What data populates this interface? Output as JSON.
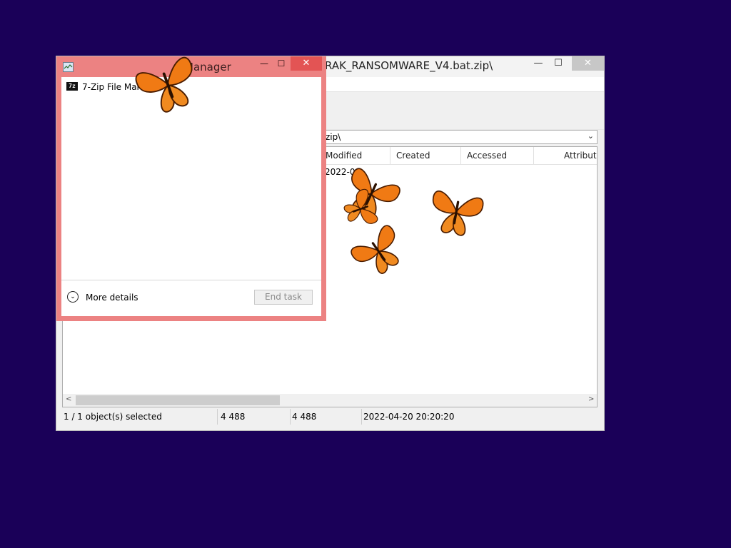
{
  "zip_window": {
    "title_partial": "RAK_RANSOMWARE_V4.bat.zip\\",
    "controls": {
      "minimize": "—",
      "maximize": "☐",
      "close": "✕"
    },
    "address_partial": "zip\\",
    "columns": [
      "Modified",
      "Created",
      "Accessed",
      "Attribute"
    ],
    "row1_modified_partial": "2022-04",
    "status": {
      "selected": "1 / 1 object(s) selected",
      "size": "4 488",
      "packed_size": "4 488",
      "modified": "2022-04-20 20:20:20"
    }
  },
  "task_manager": {
    "title_partial": "Manager",
    "controls": {
      "minimize": "—",
      "maximize": "☐",
      "close": "✕"
    },
    "apps": [
      {
        "label": "7-Zip File Manager",
        "icon": "7z"
      }
    ],
    "more_details": "More details",
    "end_task": "End task",
    "accent_color": "#ec8282"
  },
  "desktop": {
    "background_color": "#1a0058"
  },
  "decorations": {
    "butterfly_count": 5
  }
}
